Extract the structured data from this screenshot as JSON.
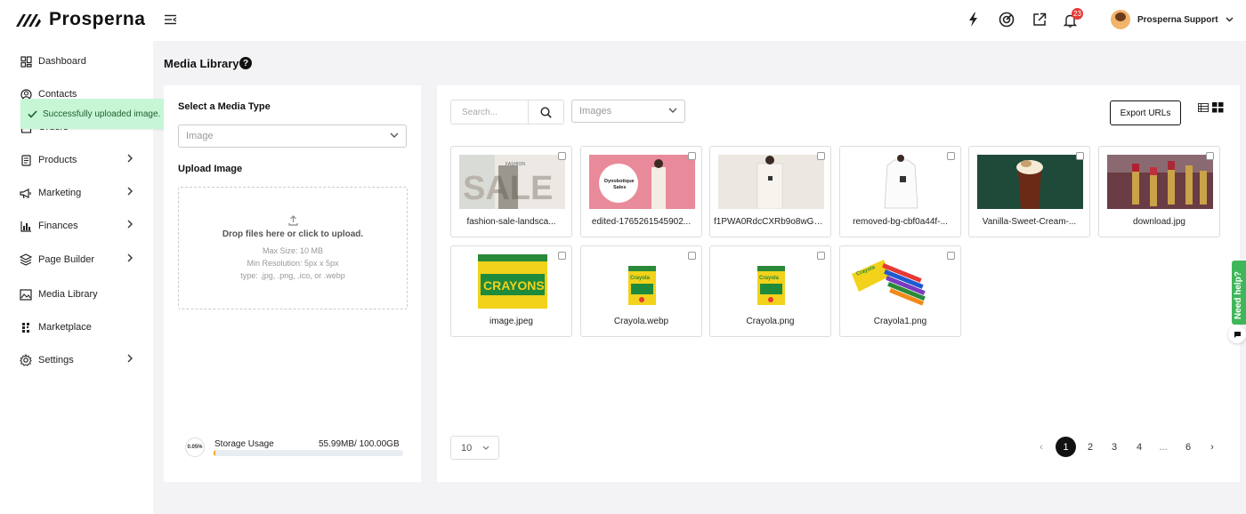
{
  "app": {
    "brand": "Prosperna"
  },
  "sidebar": {
    "items": [
      {
        "label": "Dashboard",
        "icon": "dashboard-icon"
      },
      {
        "label": "Contacts",
        "icon": "contacts-icon"
      },
      {
        "label": "Orders",
        "icon": "orders-icon"
      },
      {
        "label": "Products",
        "icon": "products-icon"
      },
      {
        "label": "Marketing",
        "icon": "megaphone-icon"
      },
      {
        "label": "Finances",
        "icon": "bar-chart-icon"
      },
      {
        "label": "Page Builder",
        "icon": "layers-icon"
      },
      {
        "label": "Media Library",
        "icon": "image-icon"
      },
      {
        "label": "Marketplace",
        "icon": "marketplace-icon"
      },
      {
        "label": "Settings",
        "icon": "gear-icon"
      }
    ]
  },
  "toast": {
    "message": "Successfully uploaded image.",
    "close": "×"
  },
  "header": {
    "notification_count": "23",
    "user_name": "Prosperna Support"
  },
  "page": {
    "title": "Media Library",
    "help": "?"
  },
  "upload": {
    "media_type_heading": "Select a Media Type",
    "media_type_value": "Image",
    "upload_heading": "Upload Image",
    "drop_text": "Drop files here or click to upload.",
    "max_size": "Max Size: 10 MB",
    "min_resolution": "Min Resolution: 5px x 5px",
    "types": "type: .jpg, .png, .ico, or .webp"
  },
  "storage": {
    "percent": "0.05%",
    "label": "Storage Usage",
    "value": "55.99MB/ 100.00GB",
    "fill_fraction": 0.0005
  },
  "library": {
    "search_placeholder": "Search...",
    "filter_value": "Images",
    "export_label": "Export URLs",
    "files": [
      {
        "name": "fashion-sale-landsca...",
        "thumb": "fashion-sale"
      },
      {
        "name": "edited-1765261545902...",
        "thumb": "dynobotique"
      },
      {
        "name": "f1PWA0RdcCXRb9o8wGzb...",
        "thumb": "white-outfit"
      },
      {
        "name": "removed-bg-cbf0a44f-...",
        "thumb": "jacket"
      },
      {
        "name": "Vanilla-Sweet-Cream-...",
        "thumb": "cold-brew"
      },
      {
        "name": "download.jpg",
        "thumb": "lipsticks"
      },
      {
        "name": "image.jpeg",
        "thumb": "crayons-large"
      },
      {
        "name": "Crayola.webp",
        "thumb": "crayola-box"
      },
      {
        "name": "Crayola.png",
        "thumb": "crayola-box"
      },
      {
        "name": "Crayola1.png",
        "thumb": "crayola-open"
      }
    ],
    "thumb_texts": {
      "sale": "SALE",
      "fashion": "FASHION",
      "dyno": "Dynobotique",
      "dyno2": "Sales",
      "crayons": "CRAYONS",
      "crayola": "Crayola"
    }
  },
  "pagination": {
    "per_page": "10",
    "prev": "‹",
    "next": "›",
    "pages": [
      "1",
      "2",
      "3",
      "4",
      "...",
      "6"
    ],
    "active": "1"
  },
  "help_widget": {
    "label": "Need help?"
  },
  "colors": {
    "accent": "#111111",
    "toast_bg": "#c6f6d5",
    "badge": "#e53935",
    "help_green": "#3fb65a",
    "storage_fill": "#f5a623"
  }
}
